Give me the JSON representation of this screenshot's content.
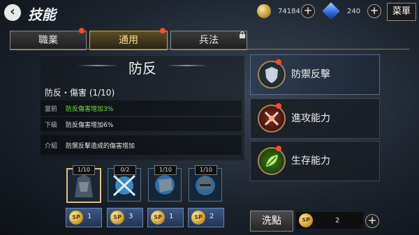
{
  "header": {
    "title": "技能",
    "gold": "74184",
    "gems": "240",
    "menu_label": "菜單"
  },
  "tabs": [
    {
      "label": "職業",
      "badge": true,
      "locked": false,
      "active": false
    },
    {
      "label": "通用",
      "badge": true,
      "locked": false,
      "active": true
    },
    {
      "label": "兵法",
      "badge": false,
      "locked": true,
      "active": false
    }
  ],
  "detail": {
    "title": "防反",
    "skill_name": "防反・傷害 (1/10)",
    "current_label": "當前",
    "current_value": "防反傷害增加3%",
    "next_label": "下級",
    "next_value": "防反傷害增加6%",
    "intro_label": "介紹",
    "intro_value": "防禦反擊造成的傷害增加"
  },
  "skills": [
    {
      "level": "1/10",
      "cost": "1",
      "selected": true
    },
    {
      "level": "0/2",
      "cost": "3",
      "selected": false
    },
    {
      "level": "1/10",
      "cost": "1",
      "selected": false
    },
    {
      "level": "1/10",
      "cost": "2",
      "selected": false
    }
  ],
  "categories": [
    {
      "label": "防禦反擊",
      "icon": "shield-icon",
      "active": true
    },
    {
      "label": "進攻能力",
      "icon": "swords-icon",
      "active": false
    },
    {
      "label": "生存能力",
      "icon": "leaf-icon",
      "active": false
    }
  ],
  "bottom": {
    "reset_label": "洗點",
    "points": "2",
    "sp_text": "SP"
  },
  "colors": {
    "accent_gold": "#e0c27a",
    "badge_red": "#ff4a2a",
    "value_green": "#6fe34a"
  }
}
